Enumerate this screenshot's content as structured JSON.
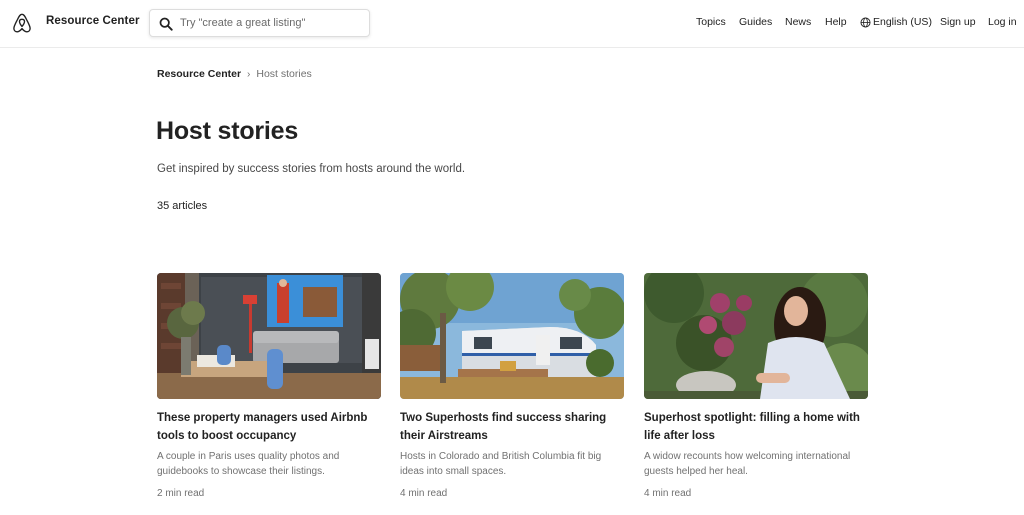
{
  "header": {
    "brand": "Resource Center",
    "search_placeholder": "Try \"create a great listing\"",
    "nav": {
      "topics": "Topics",
      "guides": "Guides",
      "news": "News",
      "help": "Help",
      "language": "English (US)",
      "signup": "Sign up",
      "login": "Log in"
    }
  },
  "breadcrumb": {
    "home": "Resource Center",
    "separator": "›",
    "current": "Host stories"
  },
  "page": {
    "title": "Host stories",
    "subtitle": "Get inspired by success stories from hosts around the world.",
    "article_count": "35 articles"
  },
  "articles": [
    {
      "title": "These property managers used Airbnb tools to boost occupancy",
      "description": "A couple in Paris uses quality photos and guidebooks to showcase their listings.",
      "read_time": "2 min read",
      "image": "living-room-photo"
    },
    {
      "title": "Two Superhosts find success sharing their Airstreams",
      "description": "Hosts in Colorado and British Columbia fit big ideas into small spaces.",
      "read_time": "4 min read",
      "image": "airstream-trailer-photo"
    },
    {
      "title": "Superhost spotlight: filling a home with life after loss",
      "description": "A widow recounts how welcoming international guests helped her heal.",
      "read_time": "4 min read",
      "image": "host-with-plant-photo"
    }
  ],
  "colors": {
    "text": "#222222",
    "muted": "#717171",
    "border": "#ebebeb"
  }
}
